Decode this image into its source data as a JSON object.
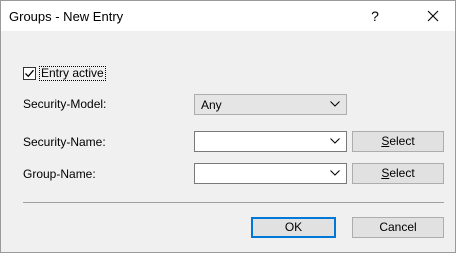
{
  "window": {
    "title": "Groups - New Entry",
    "help_label": "?"
  },
  "entry_active": {
    "label": "Entry active",
    "checked": true
  },
  "fields": {
    "security_model": {
      "label": "Security-Model:",
      "value": "Any"
    },
    "security_name": {
      "label": "Security-Name:",
      "value": "",
      "select_label_u": "S",
      "select_label_rest": "elect"
    },
    "group_name": {
      "label": "Group-Name:",
      "value": "",
      "select_label_u": "S",
      "select_label_rest": "elect"
    }
  },
  "buttons": {
    "ok": "OK",
    "cancel": "Cancel"
  },
  "icons": {
    "close": "close-icon",
    "check": "checkmark-icon",
    "dropdown": "chevron-down-icon"
  }
}
